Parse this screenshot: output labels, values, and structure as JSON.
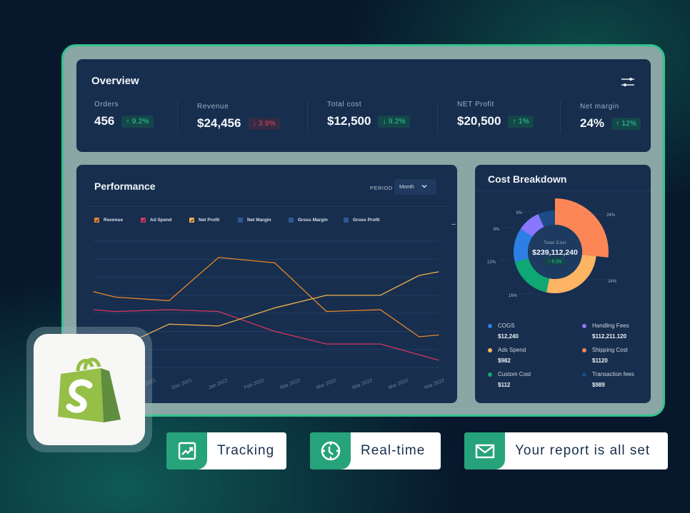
{
  "overview": {
    "title": "Overview",
    "settings_icon": "sliders-icon",
    "metrics": [
      {
        "label": "Orders",
        "value": "456",
        "change": "↑ 9.2%",
        "trend": "up"
      },
      {
        "label": "Revenue",
        "value": "$24,456",
        "change": "↓ 3.9%",
        "trend": "down"
      },
      {
        "label": "Total cost",
        "value": "$12,500",
        "change": "↓ 9.2%",
        "trend": "up"
      },
      {
        "label": "NET Profit",
        "value": "$20,500",
        "change": "↑ 1%",
        "trend": "up"
      },
      {
        "label": "Net margin",
        "value": "24%",
        "change": "↑ 12%",
        "trend": "up"
      }
    ]
  },
  "performance": {
    "title": "Performance",
    "period_label": "PERIOD",
    "period_value": "Month",
    "more_label": "...",
    "legend": [
      {
        "label": "Revenue",
        "color": "#e8862a",
        "checked": true
      },
      {
        "label": "Ad Spend",
        "color": "#d6365e",
        "checked": true
      },
      {
        "label": "Net Profit",
        "color": "#f0b04a",
        "checked": true
      },
      {
        "label": "Net Margin",
        "color": "#2f5792",
        "checked": false
      },
      {
        "label": "Gross Margin",
        "color": "#2f5792",
        "checked": false
      },
      {
        "label": "Gross Profit",
        "color": "#2f5792",
        "checked": false
      }
    ]
  },
  "chart_data": {
    "type": "line",
    "title": "Performance",
    "xlabel": "",
    "ylabel": "",
    "x_tick_labels": [
      "Nov 2021",
      "Dec 2021",
      "Jan 2022",
      "Feb 2022",
      "Mar 2022",
      "Mar 2022",
      "Mar 2022",
      "Mar 2022",
      "Mar 2022"
    ],
    "xlim": [
      0,
      16
    ],
    "ylim": [
      0,
      70
    ],
    "grid": true,
    "legend_position": "top-left",
    "series": [
      {
        "name": "Revenue",
        "color": "#e8862a",
        "x": [
          0,
          1,
          3.5,
          5.8,
          8.4,
          10.8,
          13.3,
          15.1,
          16
        ],
        "values": [
          42,
          39,
          37,
          61,
          58,
          31,
          32,
          17,
          18
        ]
      },
      {
        "name": "Ad Spend",
        "color": "#d6365e",
        "x": [
          0,
          1,
          3.5,
          5.8,
          8.4,
          10.8,
          13.3,
          15.1,
          16
        ],
        "values": [
          32,
          31,
          32,
          31,
          20,
          13,
          13,
          7,
          4
        ]
      },
      {
        "name": "Net Profit",
        "color": "#f0b04a",
        "x": [
          0,
          1.7,
          3.5,
          5.8,
          8.4,
          10.8,
          13.3,
          15.1,
          16
        ],
        "values": [
          5,
          14,
          24,
          23,
          33,
          40,
          40,
          51,
          53
        ]
      }
    ]
  },
  "cost_breakdown": {
    "title": "Cost Breakdown",
    "total_label": "Total Cost",
    "total_value": "$239,112,240",
    "total_change": "↑ 9.2%",
    "slices": [
      {
        "name": "Shipping Cost",
        "percent": 24,
        "label": "24%",
        "color": "#fd8657"
      },
      {
        "name": "Ads Spend",
        "percent": 24,
        "label": "24%",
        "color": "#fdb463"
      },
      {
        "name": "Custom Cost",
        "percent": 16,
        "label": "16%",
        "color": "#0fa874"
      },
      {
        "name": "COGS",
        "percent": 12,
        "label": "12%",
        "color": "#2d7fe5"
      },
      {
        "name": "Handling Fees",
        "percent": 8,
        "label": "8%",
        "color": "#8977fd"
      },
      {
        "name": "Transaction fees",
        "percent": 6,
        "label": "6%",
        "color": "#1e4b87"
      }
    ],
    "legend": [
      {
        "name": "COGS",
        "amount": "$12,240",
        "color": "#2d7fe5"
      },
      {
        "name": "Handling Fees",
        "amount": "$112,211.120",
        "color": "#8977fd"
      },
      {
        "name": "Ads Spend",
        "amount": "$982",
        "color": "#fdb463"
      },
      {
        "name": "Shipping Cost",
        "amount": "$1120",
        "color": "#fd8657"
      },
      {
        "name": "Custom Cost",
        "amount": "$112",
        "color": "#0fa874"
      },
      {
        "name": "Transaction fees",
        "amount": "$989",
        "color": "#1e4b87"
      }
    ]
  },
  "app_icon": "shopify-bag-icon",
  "features": [
    {
      "label": "Tracking",
      "icon": "trending-chart-icon"
    },
    {
      "label": "Real-time",
      "icon": "clock-icon"
    },
    {
      "label": "Your report is all set",
      "icon": "envelope-icon"
    }
  ]
}
